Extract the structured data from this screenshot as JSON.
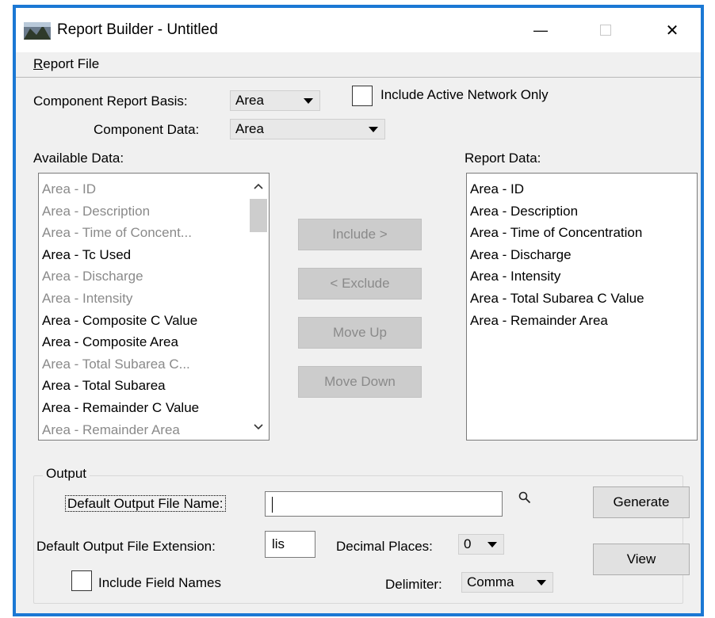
{
  "window": {
    "title": "Report Builder - Untitled",
    "minimize_glyph": "—",
    "close_glyph": "✕"
  },
  "menu": {
    "report_file": "Report File"
  },
  "basis": {
    "label": "Component Report Basis:",
    "value": "Area"
  },
  "active_network": {
    "label": "Include Active Network Only",
    "checked": false
  },
  "component_data": {
    "label": "Component Data:",
    "value": "Area"
  },
  "available": {
    "label": "Available Data:",
    "items": [
      {
        "text": "Area - ID",
        "dim": true
      },
      {
        "text": "Area - Description",
        "dim": true
      },
      {
        "text": "Area - Time of Concent...",
        "dim": true
      },
      {
        "text": "Area - Tc Used",
        "dim": false
      },
      {
        "text": "Area - Discharge",
        "dim": true
      },
      {
        "text": "Area - Intensity",
        "dim": true
      },
      {
        "text": "Area - Composite C Value",
        "dim": false
      },
      {
        "text": "Area - Composite Area",
        "dim": false
      },
      {
        "text": "Area - Total Subarea C...",
        "dim": true
      },
      {
        "text": "Area - Total Subarea",
        "dim": false
      },
      {
        "text": "Area - Remainder C Value",
        "dim": false
      },
      {
        "text": "Area - Remainder Area",
        "dim": true
      }
    ]
  },
  "report": {
    "label": "Report Data:",
    "items": [
      "Area - ID",
      "Area - Description",
      "Area - Time of Concentration",
      "Area - Discharge",
      "Area - Intensity",
      "Area - Total Subarea C Value",
      "Area - Remainder Area"
    ]
  },
  "actions": {
    "include": "Include >",
    "exclude": "< Exclude",
    "move_up": "Move Up",
    "move_down": "Move Down"
  },
  "output": {
    "group_title": "Output",
    "file_name_label": "Default Output File Name:",
    "file_name_value": "",
    "extension_label": "Default Output File Extension:",
    "extension_value": "lis",
    "decimal_label": "Decimal Places:",
    "decimal_value": "0",
    "include_field_names_label": "Include Field Names",
    "include_field_names_checked": false,
    "delimiter_label": "Delimiter:",
    "delimiter_value": "Comma",
    "generate": "Generate",
    "view": "View"
  },
  "colors": {
    "window_border": "#1b78d4",
    "dialog_bg": "#f0f0f0",
    "disabled_text": "#8a8a8a"
  }
}
